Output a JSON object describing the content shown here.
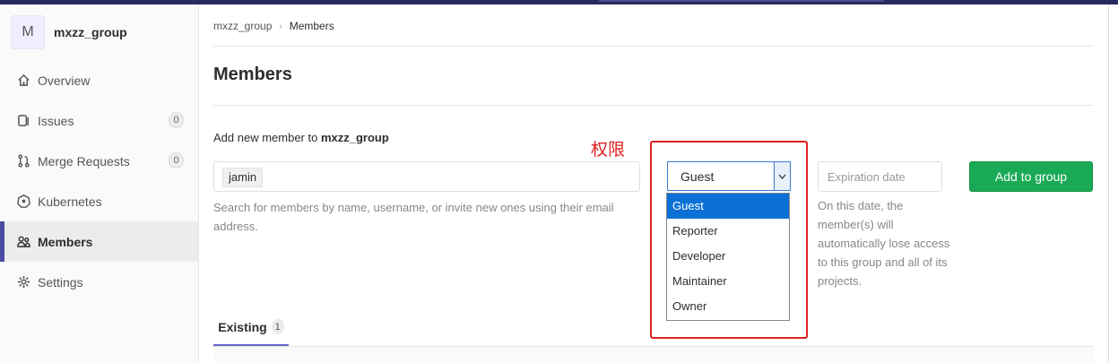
{
  "sidebar": {
    "avatar_letter": "M",
    "group_name": "mxzz_group",
    "items": [
      {
        "label": "Overview",
        "icon": "home-icon"
      },
      {
        "label": "Issues",
        "icon": "issues-icon",
        "count": "0"
      },
      {
        "label": "Merge Requests",
        "icon": "merge-request-icon",
        "count": "0"
      },
      {
        "label": "Kubernetes",
        "icon": "kubernetes-icon"
      },
      {
        "label": "Members",
        "icon": "members-icon",
        "active": true
      },
      {
        "label": "Settings",
        "icon": "gear-icon"
      }
    ]
  },
  "breadcrumb": {
    "parent": "mxzz_group",
    "current": "Members"
  },
  "page_title": "Members",
  "add_member": {
    "label_prefix": "Add new member to",
    "group": "mxzz_group",
    "search_token": "jamin",
    "search_help": "Search for members by name, username, or invite new ones using their email address."
  },
  "annotation": "权限",
  "role_select": {
    "value": "Guest",
    "options": [
      "Guest",
      "Reporter",
      "Developer",
      "Maintainer",
      "Owner"
    ],
    "selected_index": 0
  },
  "expiration": {
    "placeholder": "Expiration date",
    "help": "On this date, the member(s) will automatically lose access to this group and all of its projects."
  },
  "add_button": "Add to group",
  "tabs": [
    {
      "label": "Existing",
      "count": "1"
    }
  ],
  "colors": {
    "accent": "#1aaa55",
    "annotation": "#e02020",
    "selected_option": "#0b71d6"
  }
}
